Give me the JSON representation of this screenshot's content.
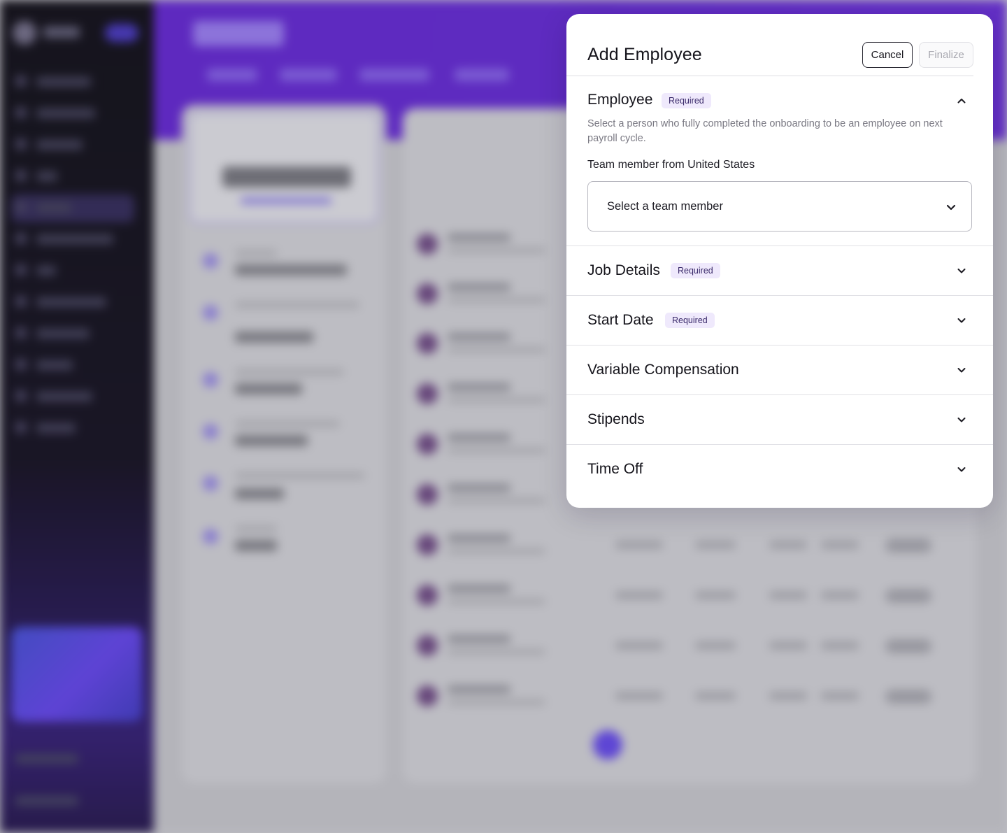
{
  "modal": {
    "title": "Add Employee",
    "cancel_label": "Cancel",
    "finalize_label": "Finalize"
  },
  "sections": [
    {
      "title": "Employee",
      "badge": "Required",
      "expanded": true,
      "description": "Select a person who fully completed the onboarding to be an employee on next payroll cycle.",
      "field_label": "Team member from United States",
      "select_placeholder": "Select a team member"
    },
    {
      "title": "Job Details",
      "badge": "Required",
      "expanded": false
    },
    {
      "title": "Start Date",
      "badge": "Required",
      "expanded": false
    },
    {
      "title": "Variable Compensation",
      "expanded": false
    },
    {
      "title": "Stipends",
      "expanded": false
    },
    {
      "title": "Time Off",
      "expanded": false
    }
  ],
  "colors": {
    "accent": "#5b20c9",
    "badge_bg": "#efe9fc",
    "text_primary": "#16151c",
    "text_muted": "#7a7983"
  },
  "icons": {
    "collapse": "chevron-up-icon",
    "expand": "chevron-down-icon"
  }
}
